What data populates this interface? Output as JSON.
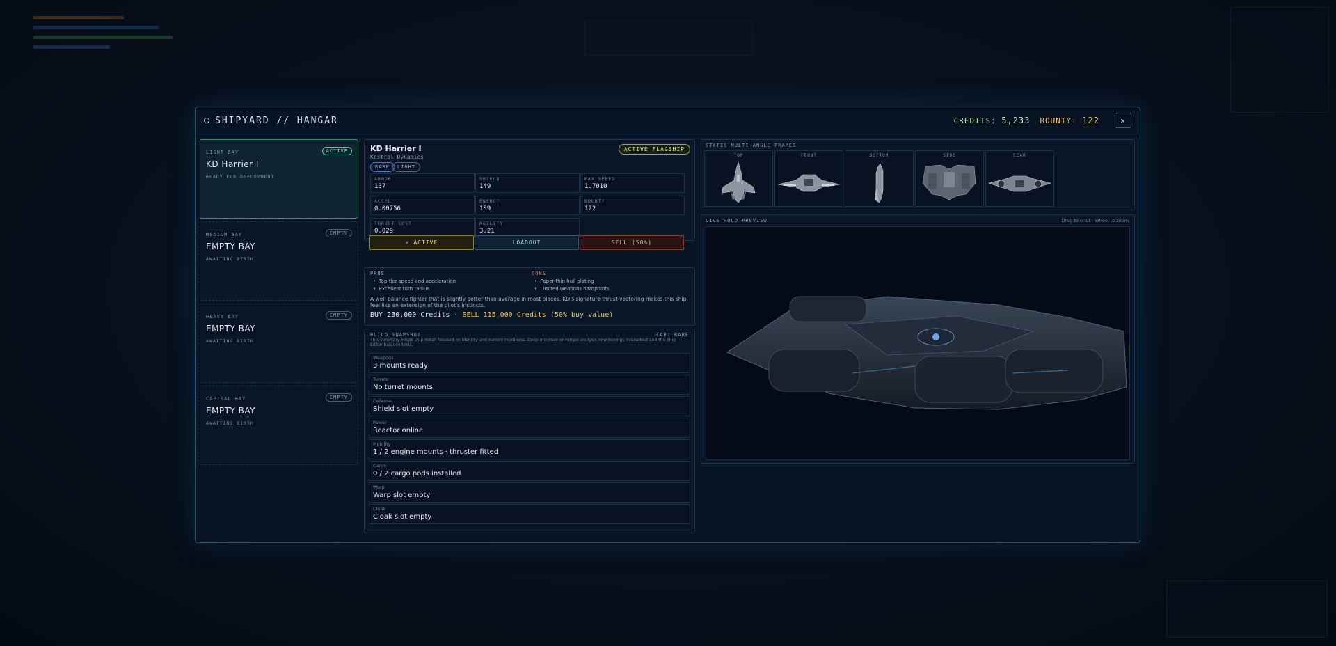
{
  "header": {
    "title": "SHIPYARD // HANGAR",
    "credits_label": "CREDITS:",
    "credits_value": "5,233",
    "bounty_label": "BOUNTY:",
    "bounty_value": "122",
    "close_glyph": "✕"
  },
  "bays": [
    {
      "type": "LIGHT BAY",
      "badge": "ACTIVE",
      "name": "KD Harrier I",
      "status": "READY FOR DEPLOYMENT"
    },
    {
      "type": "MEDIUM BAY",
      "badge": "EMPTY",
      "name": "EMPTY BAY",
      "status": "AWAITING BIRTH"
    },
    {
      "type": "HEAVY BAY",
      "badge": "EMPTY",
      "name": "EMPTY BAY",
      "status": "AWAITING BIRTH"
    },
    {
      "type": "CAPITAL BAY",
      "badge": "EMPTY",
      "name": "EMPTY BAY",
      "status": "AWAITING BIRTH"
    }
  ],
  "ship": {
    "name": "KD Harrier I",
    "manufacturer": "Kestrel Dynamics",
    "flagship_badge": "ACTIVE FLAGSHIP",
    "tags": [
      "RARE",
      "LIGHT"
    ],
    "stats": [
      {
        "label": "ARMOR",
        "value": "137"
      },
      {
        "label": "SHIELD",
        "value": "149"
      },
      {
        "label": "MAX SPEED",
        "value": "1.7010"
      },
      {
        "label": "ACCEL",
        "value": "0.00756"
      },
      {
        "label": "ENERGY",
        "value": "189"
      },
      {
        "label": "BOUNTY",
        "value": "122"
      },
      {
        "label": "THRUST COST",
        "value": "0.029"
      },
      {
        "label": "AGILITY",
        "value": "3.21"
      }
    ],
    "actions": {
      "active": "⚡ ACTIVE",
      "loadout": "LOADOUT",
      "sell": "SELL (50%)"
    }
  },
  "pros_cons": {
    "pros_label": "PROS",
    "pros": [
      "Top-tier speed and acceleration",
      "Excellent turn radius"
    ],
    "cons_label": "CONS",
    "cons": [
      "Paper-thin hull plating",
      "Limited weapons hardpoints"
    ],
    "description": "A well balance fighter that is slightly better than average in most places. KD's signature thrust-vectoring makes this ship feel like an extension of the pilot's instincts.",
    "buy_text": "BUY 230,000 Credits",
    "separator": "·",
    "sell_text": "SELL 115,000 Credits",
    "sell_pct": "(50% buy value)"
  },
  "snapshot": {
    "title": "BUILD SNAPSHOT",
    "cap": "CAP: RARE",
    "note": "This summary keeps ship detail focused on identity and current readiness. Deep min/max envelope analysis now belongs in Loadout and the Ship Editor balance tools.",
    "slots": [
      {
        "label": "Weapons",
        "value": "3 mounts ready"
      },
      {
        "label": "Turrets",
        "value": "No turret mounts"
      },
      {
        "label": "Defense",
        "value": "Shield slot empty"
      },
      {
        "label": "Power",
        "value": "Reactor online"
      },
      {
        "label": "Mobility",
        "value": "1 / 2 engine mounts · thruster fitted"
      },
      {
        "label": "Cargo",
        "value": "0 / 2 cargo pods installed"
      },
      {
        "label": "Warp",
        "value": "Warp slot empty"
      },
      {
        "label": "Cloak",
        "value": "Cloak slot empty"
      }
    ]
  },
  "frames": {
    "title": "STATIC MULTI-ANGLE FRAMES",
    "views": [
      "TOP",
      "FRONT",
      "BOTTOM",
      "SIDE",
      "REAR"
    ]
  },
  "holo": {
    "title": "LIVE HOLO PREVIEW",
    "hint": "Drag to orbit · Wheel to zoom"
  },
  "colors": {
    "accent": "#56c49a",
    "credits": "#a8e6a0",
    "bounty": "#f0c050",
    "sell": "#f0c040"
  }
}
